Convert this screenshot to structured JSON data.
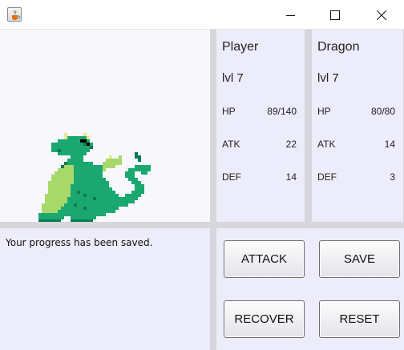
{
  "window": {
    "icon": "java-cup-icon",
    "controls": [
      "minimize-icon",
      "maximize-icon",
      "close-icon"
    ]
  },
  "player": {
    "name": "Player",
    "level": "lvl 7",
    "hp_label": "HP",
    "hp": "89/140",
    "atk_label": "ATK",
    "atk": "22",
    "def_label": "DEF",
    "def": "14"
  },
  "enemy": {
    "name": "Dragon",
    "level": "lvl 7",
    "hp_label": "HP",
    "hp": "80/80",
    "atk_label": "ATK",
    "atk": "14",
    "def_label": "DEF",
    "def": "3"
  },
  "log": {
    "message": "Your progress has been saved."
  },
  "actions": {
    "attack": "ATTACK",
    "save": "SAVE",
    "recover": "RECOVER",
    "reset": "RESET"
  },
  "colors": {
    "dragon_body": "#1aa870",
    "dragon_dark": "#0e7a4e",
    "dragon_belly": "#a8d86a",
    "dragon_horn": "#e8e890",
    "panel_bg": "#ececfa",
    "divider": "#d6d6dc"
  }
}
